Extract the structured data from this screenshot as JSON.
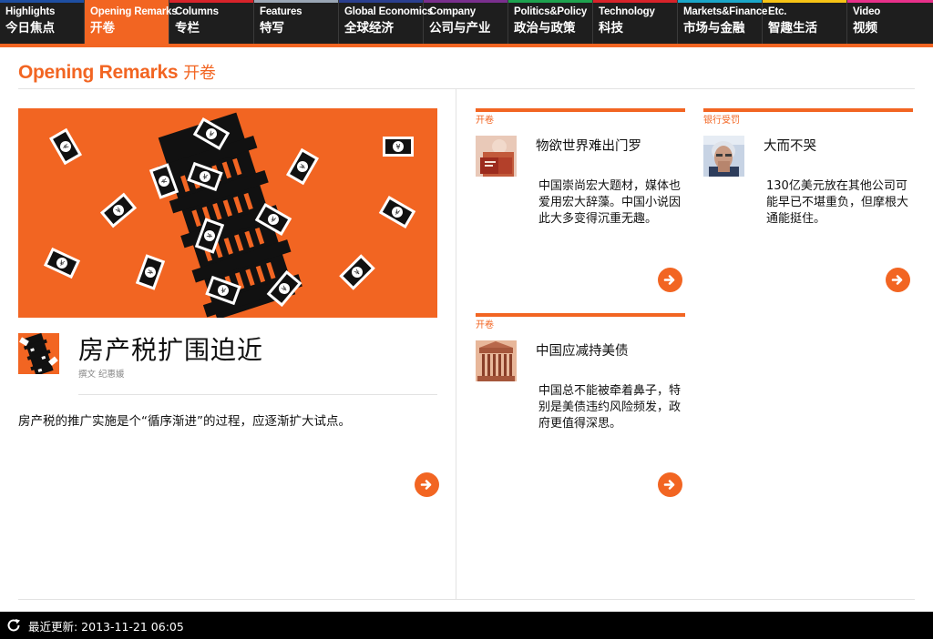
{
  "nav": {
    "tabs": [
      {
        "en": "Highlights",
        "zh": "今日焦点",
        "stripe": "#1e4fa3",
        "active": false
      },
      {
        "en": "Opening Remarks",
        "zh": "开卷",
        "stripe": "#f26522",
        "active": true
      },
      {
        "en": "Columns",
        "zh": "专栏",
        "stripe": "#d8232a",
        "active": false
      },
      {
        "en": "Features",
        "zh": "特写",
        "stripe": "#9aa6b5",
        "active": false
      },
      {
        "en": "Global Economics",
        "zh": "全球经济",
        "stripe": "#2a3f8f",
        "active": false
      },
      {
        "en": "Company",
        "zh": "公司与产业",
        "stripe": "#7a2f8e",
        "active": false
      },
      {
        "en": "Politics&Policy",
        "zh": "政治与政策",
        "stripe": "#1ea34f",
        "active": false
      },
      {
        "en": "Technology",
        "zh": "科技",
        "stripe": "#d8232a",
        "active": false
      },
      {
        "en": "Markets&Finance",
        "zh": "市场与金融",
        "stripe": "#1aa7c9",
        "active": false
      },
      {
        "en": "Etc.",
        "zh": "智趣生活",
        "stripe": "#f7c315",
        "active": false
      },
      {
        "en": "Video",
        "zh": "视频",
        "stripe": "#e8308a",
        "active": false
      }
    ]
  },
  "section": {
    "title_en": "Opening Remarks",
    "title_zh": "开卷"
  },
  "lead": {
    "title": "房产税扩围迫近",
    "byline": "撰文 纪惠媛",
    "summary": "房产税的推广实施是个“循序渐进”的过程，应逐渐扩大试点。"
  },
  "cards": [
    {
      "category": "开卷",
      "title": "物欲世界难出门罗",
      "summary": "中国崇尚宏大题材，媒体也爱用宏大辞藻。中国小说因此大多变得沉重无趣。"
    },
    {
      "category": "银行受罚",
      "title": "大而不哭",
      "summary": "130亿美元放在其他公司可能早已不堪重负，但摩根大通能挺住。"
    },
    {
      "category": "开卷",
      "title": "中国应减持美债",
      "summary": "中国总不能被牵着鼻子，特别是美债违约风险频发，政府更值得深思。"
    }
  ],
  "status": {
    "text": "最近更新: 2013-11-21 06:05"
  },
  "colors": {
    "accent": "#f26522",
    "nav_bg": "#1e1e1e"
  }
}
